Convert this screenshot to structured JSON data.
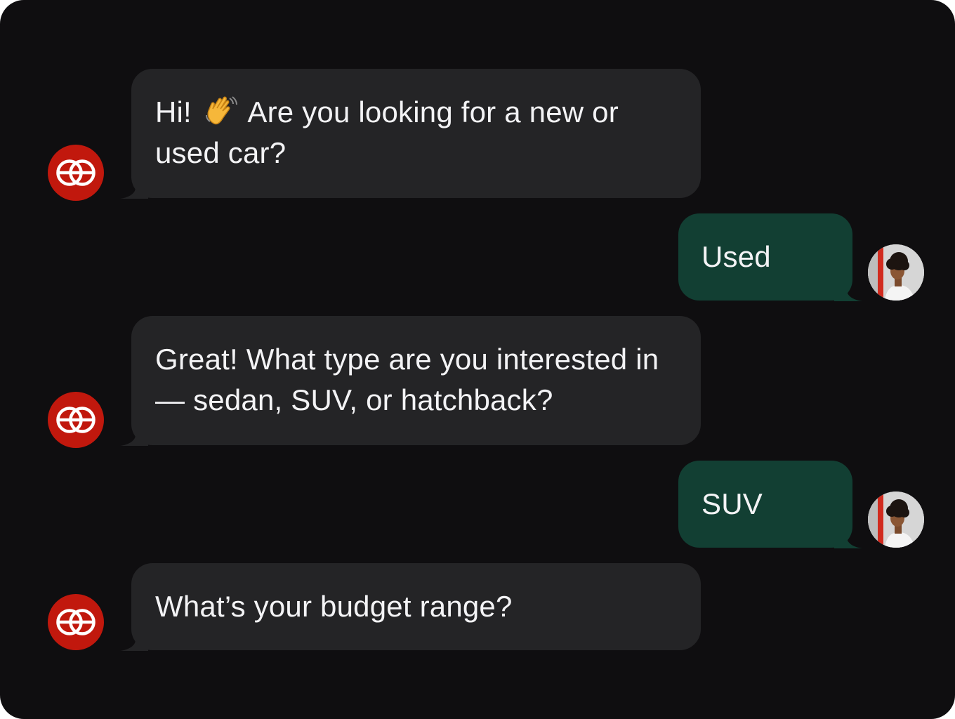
{
  "chat": {
    "messages": [
      {
        "sender": "bot",
        "text_before_emoji": "Hi! ",
        "emoji": "waving-hand-icon",
        "text_after_emoji": " Are you looking for a new or used car?"
      },
      {
        "sender": "user",
        "text": "Used"
      },
      {
        "sender": "bot",
        "text": "Great! What type are you interested in — sedan, SUV, or hatchback?"
      },
      {
        "sender": "user",
        "text": "SUV"
      },
      {
        "sender": "bot",
        "text": "What’s your budget range?"
      }
    ]
  },
  "colors": {
    "background": "#0f0e10",
    "bot_bubble": "#242426",
    "user_bubble": "#123f33",
    "bot_avatar": "#c1180d",
    "text": "#f3f3f5"
  },
  "icons": {
    "bot_avatar": "interlocking-rings-logo-icon",
    "user_avatar": "user-photo-avatar"
  }
}
